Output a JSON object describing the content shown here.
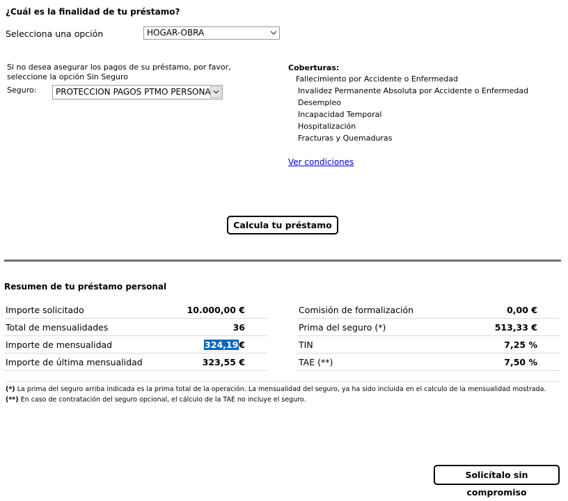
{
  "finalidad": {
    "question": "¿Cuál es la finalidad de tu préstamo?",
    "option_label": "Selecciona una opción",
    "selected": "HOGAR-OBRA"
  },
  "seguro": {
    "note": "Si no desea asegurar los pagos de su préstamo, por favor, seleccione la opción Sin Seguro",
    "label": "Seguro:",
    "selected": "PROTECCION PAGOS PTMO PERSONAL"
  },
  "coberturas": {
    "title": "Coberturas:",
    "items": [
      "Fallecimiento por Accidente o Enfermedad",
      "Invalidez Permanente Absoluta por Accidente o Enfermedad",
      "Desempleo",
      "Incapacidad Temporal",
      "Hospitalización",
      "Fracturas y Quemaduras"
    ],
    "link": "Ver condiciones"
  },
  "calcula_button": "Calcula tu préstamo",
  "resumen": {
    "title": "Resumen de tu préstamo personal",
    "left_rows": [
      {
        "label": "Importe solicitado",
        "value": "10.000,00 €"
      },
      {
        "label": "Total de mensualidades",
        "value": "36"
      },
      {
        "label": "Importe de mensualidad",
        "value": "324,19",
        "suffix": "€"
      },
      {
        "label": "Importe de última mensualidad",
        "value": "323,55 €"
      }
    ],
    "right_rows": [
      {
        "label": "Comisión de formalización",
        "value": "0,00 €"
      },
      {
        "label": "Prima del seguro (*)",
        "value": "513,33 €"
      },
      {
        "label": "TIN",
        "value": "7,25 %"
      },
      {
        "label": "TAE (**)",
        "value": "7,50 %"
      }
    ]
  },
  "notes": {
    "n1_mark": "(*)",
    "n1_text": " La prima del seguro arriba indicada es la prima total de la operación. La mensualidad del seguro, ya ha sido incluida en el calculo de la mensualidad mostrada.",
    "n2_mark": "(**)",
    "n2_text": " En caso de contratación del seguro opcional, el cálculo de la TAE no incluye el seguro."
  },
  "solicita_button": "Solicítalo sin compromiso",
  "colors": {
    "highlight": "#0a66c2",
    "link": "#0000cc",
    "divider": "#6e6e6e"
  }
}
